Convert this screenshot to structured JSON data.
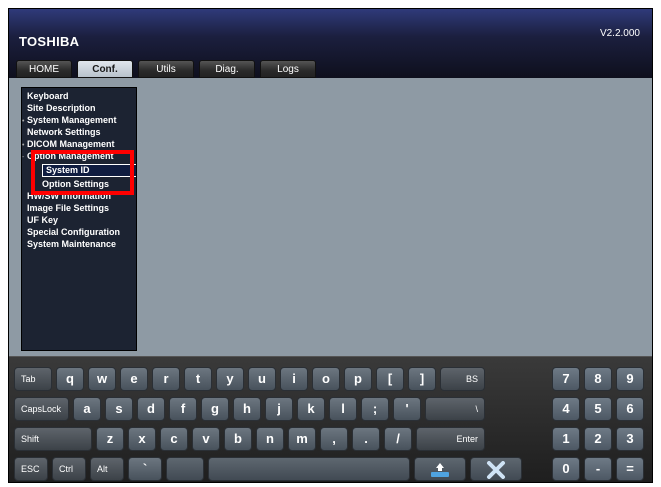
{
  "header": {
    "brand": "TOSHIBA",
    "version": "V2.2.000"
  },
  "tabs": [
    {
      "label": "HOME",
      "active": false
    },
    {
      "label": "Conf.",
      "active": true
    },
    {
      "label": "Utils",
      "active": false
    },
    {
      "label": "Diag.",
      "active": false
    },
    {
      "label": "Logs",
      "active": false
    }
  ],
  "sidebar": {
    "items": [
      {
        "label": "Keyboard"
      },
      {
        "label": "Site Description"
      },
      {
        "label": "System Management",
        "bullet": true
      },
      {
        "label": "Network Settings"
      },
      {
        "label": "DICOM Management",
        "bullet": true
      },
      {
        "label": "Option Management",
        "bullet": true
      },
      {
        "label": "System ID",
        "selected": true
      },
      {
        "label": "Option Settings"
      },
      {
        "label": "HW/SW Information"
      },
      {
        "label": "Image File Settings"
      },
      {
        "label": "UF Key"
      },
      {
        "label": "Special Configuration"
      },
      {
        "label": "System Maintenance"
      }
    ]
  },
  "keyboard": {
    "row1": [
      "Tab",
      "q",
      "w",
      "e",
      "r",
      "t",
      "y",
      "u",
      "i",
      "o",
      "p",
      "[",
      "]",
      "BS",
      "7",
      "8",
      "9"
    ],
    "row2": [
      "CapsLock",
      "a",
      "s",
      "d",
      "f",
      "g",
      "h",
      "j",
      "k",
      "l",
      ";",
      "'",
      "\\",
      "4",
      "5",
      "6"
    ],
    "row3": [
      "Shift",
      "z",
      "x",
      "c",
      "v",
      "b",
      "n",
      "m",
      ",",
      ".",
      "/",
      "Enter",
      "1",
      "2",
      "3"
    ],
    "row4": [
      "ESC",
      "Ctrl",
      "Alt",
      "`",
      "",
      "",
      "",
      "",
      "0",
      "-",
      "="
    ]
  },
  "icons": {
    "keyboard_hide": "keyboard-hide-icon",
    "close": "close-x-icon"
  }
}
